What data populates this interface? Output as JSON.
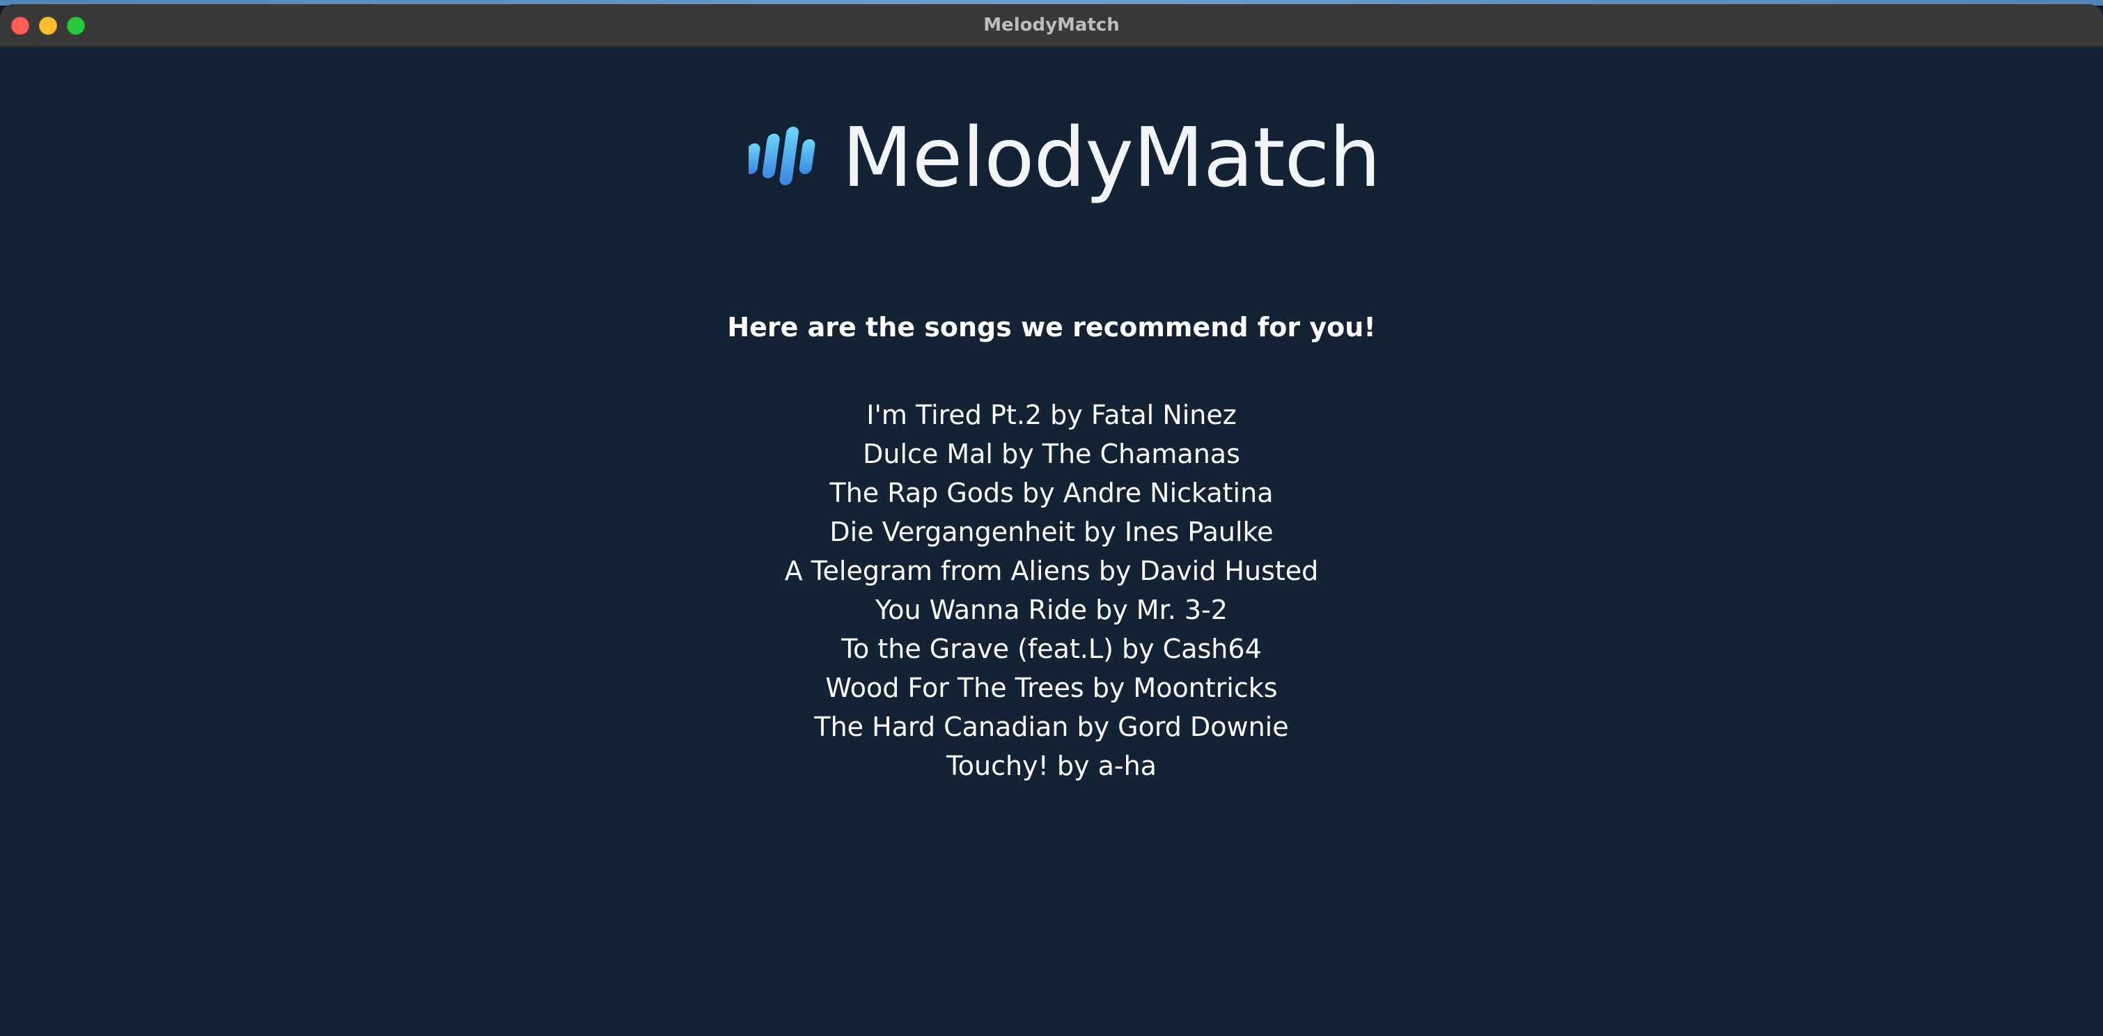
{
  "window": {
    "title": "MelodyMatch"
  },
  "logo": {
    "text": "MelodyMatch",
    "icon": "audio-bars-icon",
    "gradient": [
      "#5fd0f5",
      "#3a8fe8"
    ]
  },
  "heading": "Here are the songs we recommend for you!",
  "songs": [
    "I'm Tired Pt.2 by Fatal Ninez",
    "Dulce Mal by The Chamanas",
    "The Rap Gods by Andre Nickatina",
    "Die Vergangenheit by Ines Paulke",
    "A Telegram from Aliens by David Husted",
    "You Wanna Ride by Mr. 3-2",
    "To the Grave (feat.L) by Cash64",
    "Wood For The Trees by Moontricks",
    "The Hard Canadian by Gord Downie",
    "Touchy! by a-ha"
  ],
  "colors": {
    "background": "#132235",
    "titlebar": "#393939",
    "text": "#ffffff"
  }
}
